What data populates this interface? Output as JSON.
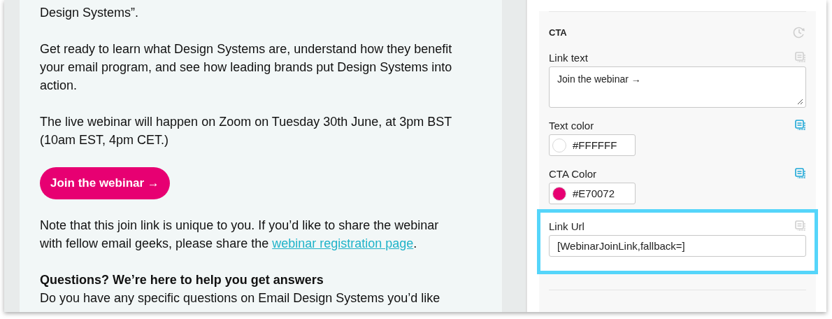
{
  "email": {
    "paragraphs": [
      {
        "kind": "text",
        "text": "Design Systems”."
      },
      {
        "kind": "text",
        "text": "Get ready to learn what Design Systems are, understand how they benefit your email program, and see how leading brands put Design Systems into action."
      },
      {
        "kind": "text",
        "text": "The live webinar will happen on Zoom on Tuesday 30th June, at 3pm BST (10am EST, 4pm CET.)"
      },
      {
        "kind": "button",
        "text": "Join the webinar →"
      },
      {
        "kind": "note",
        "text": "Note that this join link is unique to you. If you’d like to share the webinar with fellow email geeks, please share the ",
        "link": "webinar registration page",
        "after": "."
      },
      {
        "kind": "heading",
        "text": "Questions? We’re here to help you get answers"
      },
      {
        "kind": "text",
        "text": "Do you have any specific questions on Email Design Systems you’d like"
      }
    ]
  },
  "panel": {
    "section_title": "CTA",
    "fields": [
      {
        "kind": "textarea",
        "label": "Link text",
        "value": "Join the webinar →",
        "linked": false,
        "highlighted": false
      },
      {
        "kind": "color",
        "label": "Text color",
        "value": "#FFFFFF",
        "color": "#ffffff",
        "linked": true,
        "highlighted": false
      },
      {
        "kind": "color",
        "label": "CTA Color",
        "value": "#E70072",
        "color": "#e70072",
        "linked": true,
        "highlighted": false
      },
      {
        "kind": "text",
        "label": "Link Url",
        "value": "[WebinarJoinLink,fallback=]",
        "linked": false,
        "highlighted": true
      }
    ]
  }
}
